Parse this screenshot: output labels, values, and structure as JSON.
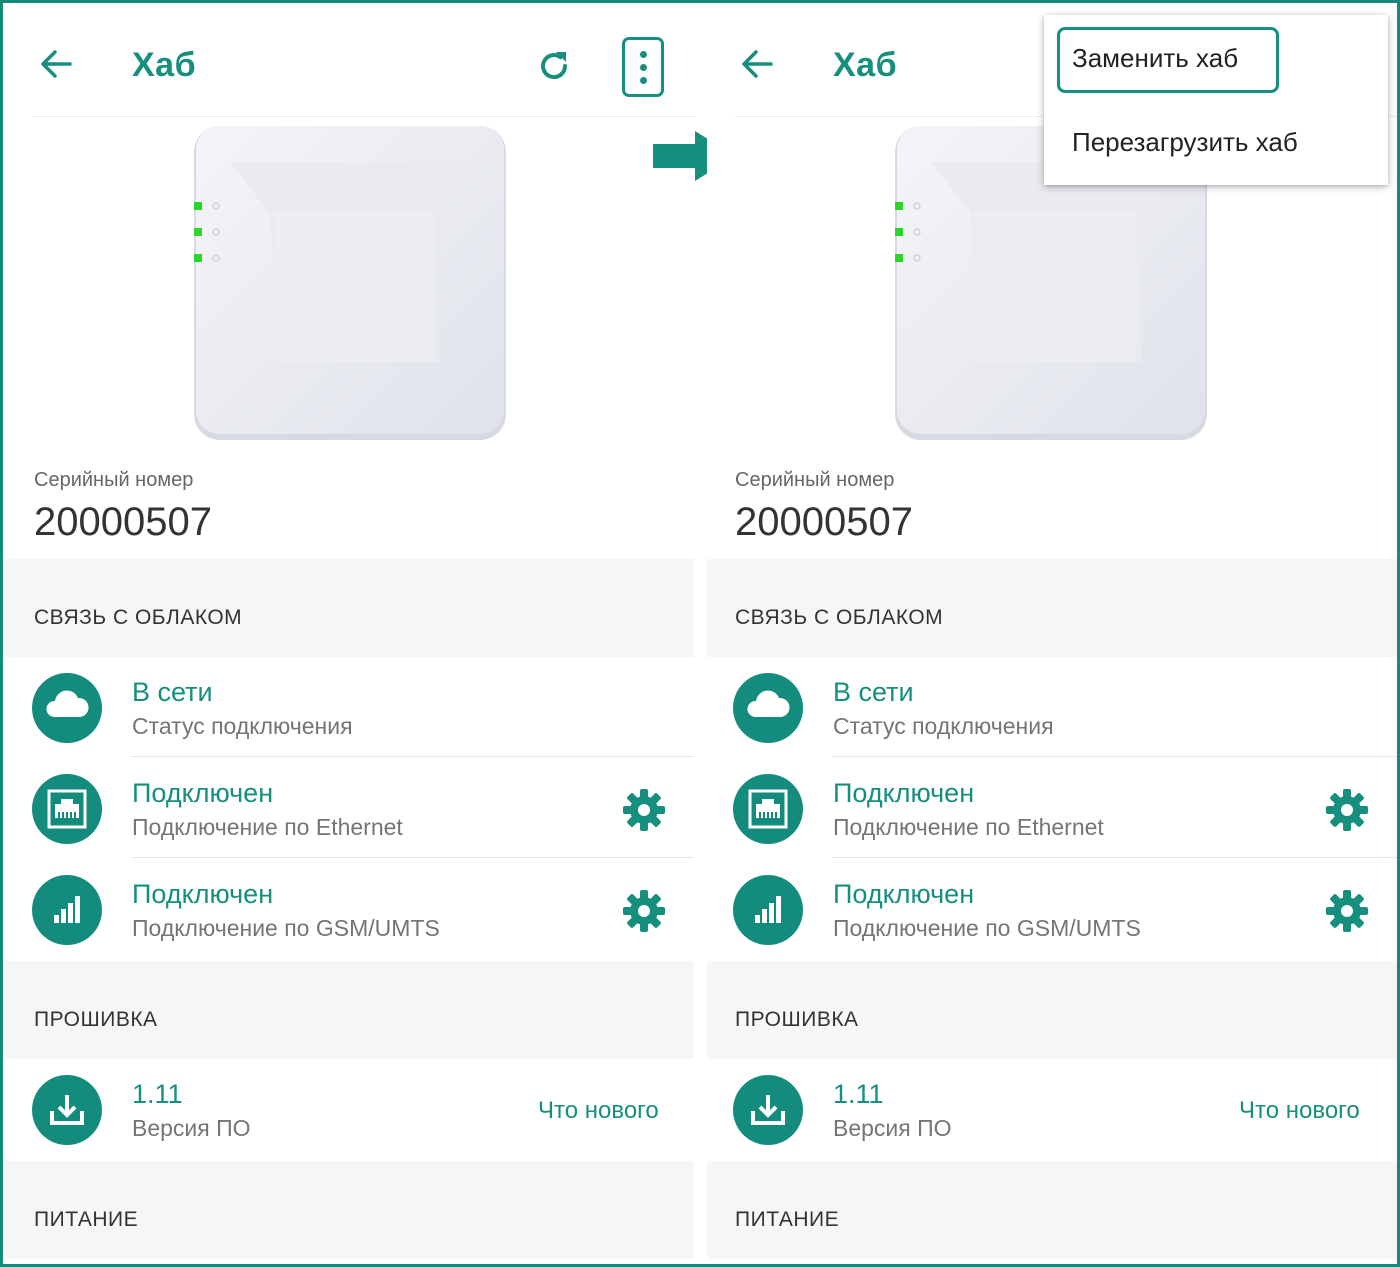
{
  "colors": {
    "accent": "#168f7e",
    "frame": "#15897a",
    "section_bg": "#f6f6f6"
  },
  "screens": [
    {
      "appbar": {
        "title": "Хаб",
        "back_icon": "arrow-left-icon",
        "refresh_icon": "refresh-icon",
        "more_icon": "more-vertical-icon"
      },
      "serial": {
        "label": "Серийный номер",
        "value": "20000507"
      },
      "cloud": {
        "header": "СВЯЗЬ С ОБЛАКОМ",
        "rows": [
          {
            "icon": "cloud-icon",
            "status": "В сети",
            "description": "Статус подключения"
          },
          {
            "icon": "ethernet-icon",
            "status": "Подключен",
            "description": "Подключение по Ethernet",
            "settings_icon": "gear-icon"
          },
          {
            "icon": "signal-bars-icon",
            "status": "Подключен",
            "description": "Подключение по GSM/UMTS",
            "settings_icon": "gear-icon"
          }
        ]
      },
      "firmware": {
        "header": "ПРОШИВКА",
        "version": "1.11",
        "version_label": "Версия ПО",
        "whats_new": "Что нового",
        "icon": "download-icon"
      },
      "power": {
        "header": "ПИТАНИЕ"
      }
    },
    {
      "appbar": {
        "title": "Хаб",
        "back_icon": "arrow-left-icon"
      },
      "serial": {
        "label": "Серийный номер",
        "value": "20000507"
      },
      "cloud": {
        "header": "СВЯЗЬ С ОБЛАКОМ",
        "rows": [
          {
            "icon": "cloud-icon",
            "status": "В сети",
            "description": "Статус подключения"
          },
          {
            "icon": "ethernet-icon",
            "status": "Подключен",
            "description": "Подключение по Ethernet",
            "settings_icon": "gear-icon"
          },
          {
            "icon": "signal-bars-icon",
            "status": "Подключен",
            "description": "Подключение по GSM/UMTS",
            "settings_icon": "gear-icon"
          }
        ]
      },
      "firmware": {
        "header": "ПРОШИВКА",
        "version": "1.11",
        "version_label": "Версия ПО",
        "whats_new": "Что нового",
        "icon": "download-icon"
      },
      "power": {
        "header": "ПИТАНИЕ"
      }
    }
  ],
  "overflow_menu": {
    "items": [
      "Заменить хаб",
      "Перезагрузить хаб"
    ],
    "highlighted_item": "Заменить хаб"
  },
  "transition_icon": "arrow-right-icon"
}
